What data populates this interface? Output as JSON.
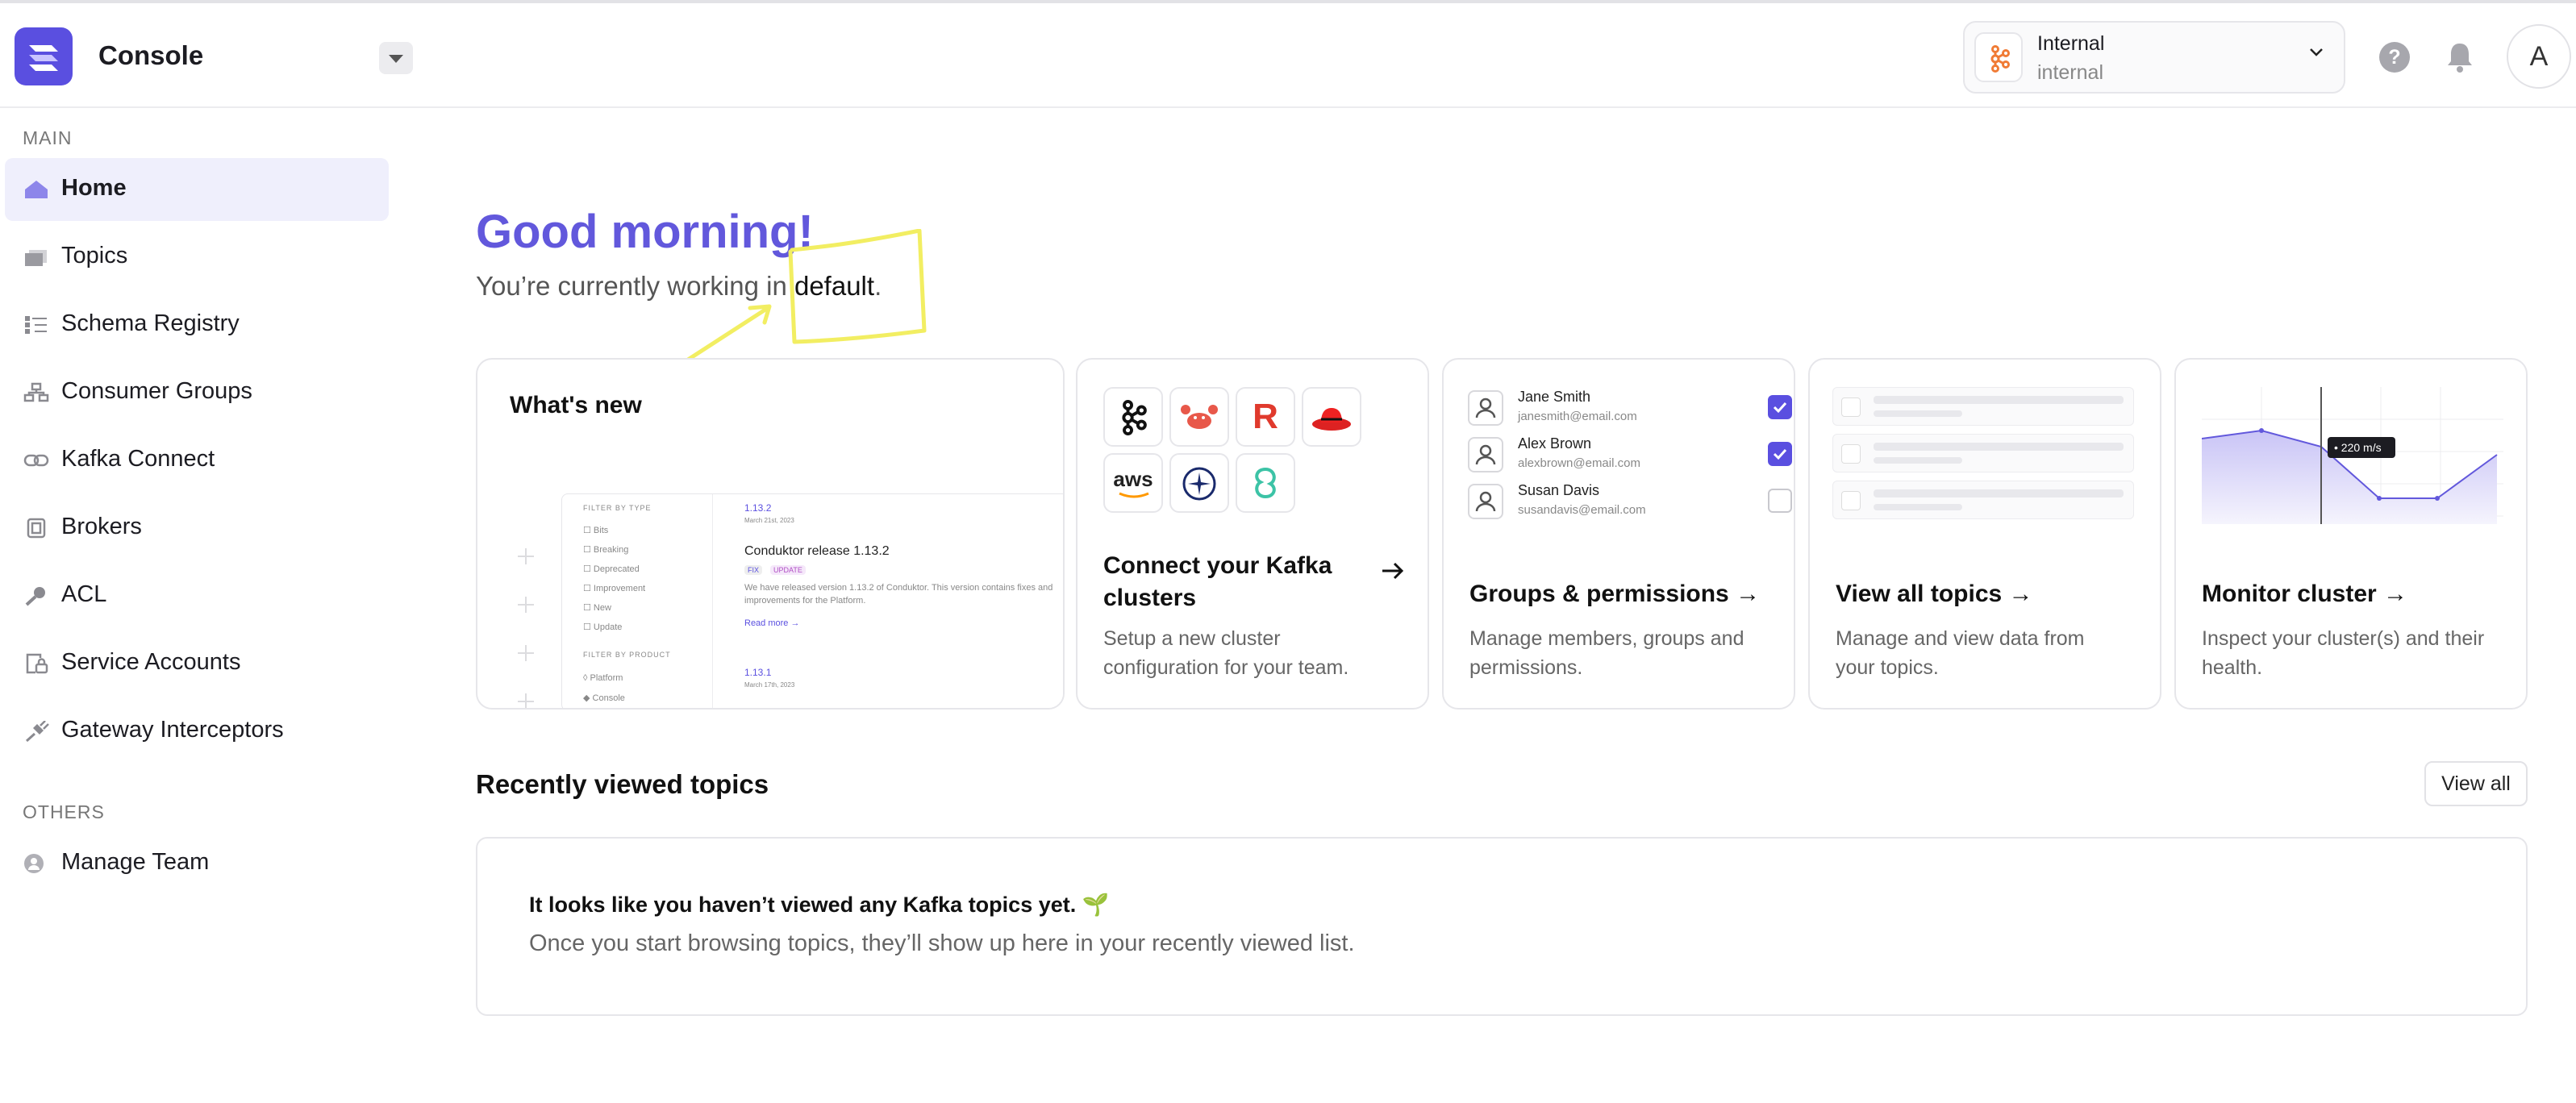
{
  "app": {
    "title": "Console"
  },
  "cluster": {
    "name": "Internal",
    "subtitle": "internal"
  },
  "help": {
    "label": "?"
  },
  "user": {
    "avatar_initial": "A"
  },
  "sidebar": {
    "sections": [
      {
        "title": "MAIN",
        "items": [
          {
            "label": "Home",
            "icon": "home-icon",
            "active": true
          },
          {
            "label": "Topics",
            "icon": "topics-icon"
          },
          {
            "label": "Schema Registry",
            "icon": "schema-icon"
          },
          {
            "label": "Consumer Groups",
            "icon": "consumer-groups-icon"
          },
          {
            "label": "Kafka Connect",
            "icon": "kafka-connect-icon"
          },
          {
            "label": "Brokers",
            "icon": "brokers-icon"
          },
          {
            "label": "ACL",
            "icon": "key-icon"
          },
          {
            "label": "Service Accounts",
            "icon": "service-accounts-icon"
          },
          {
            "label": "Gateway Interceptors",
            "icon": "plug-icon"
          }
        ]
      },
      {
        "title": "OTHERS",
        "items": [
          {
            "label": "Manage Team",
            "icon": "team-icon"
          }
        ]
      }
    ]
  },
  "main": {
    "greeting": "Good morning!",
    "working_prefix": "You’re currently working in ",
    "working_env": "default",
    "working_suffix": "."
  },
  "cards": {
    "whats_new": {
      "title": "What's new",
      "preview": {
        "filter_by_type": "FILTER BY TYPE",
        "types": [
          "Bits",
          "Breaking",
          "Deprecated",
          "Improvement",
          "New",
          "Update"
        ],
        "filter_by_product": "FILTER BY PRODUCT",
        "products": [
          "Platform",
          "Console"
        ],
        "version1": "1.13.2",
        "date1": "March 21st, 2023",
        "release_title": "Conduktor release 1.13.2",
        "badges": [
          "FIX",
          "UPDATE"
        ],
        "release_text_1": "We have released version 1.13.2 of Conduktor. This version contains fixes and",
        "release_text_2": "improvements for the Platform.",
        "read_more": "Read more →",
        "version2": "1.13.1",
        "date2": "March 17th, 2023"
      }
    },
    "connect": {
      "title_line1": "Connect your Kafka",
      "title_line2": "clusters",
      "desc_line1": "Setup a new cluster",
      "desc_line2": "configuration for your team.",
      "tiles": [
        "kafka-icon",
        "crab-icon",
        "redpanda-icon",
        "redhat-icon",
        "aws-icon",
        "aiven-icon",
        "confluent-icon"
      ],
      "aws_text": "aws",
      "redpanda_text": "R"
    },
    "groups": {
      "title": "Groups & permissions →",
      "desc_line1": "Manage members, groups and",
      "desc_line2": "permissions.",
      "members": [
        {
          "name": "Jane Smith",
          "email": "janesmith@email.com",
          "checked": true
        },
        {
          "name": "Alex Brown",
          "email": "alexbrown@email.com",
          "checked": true
        },
        {
          "name": "Susan Davis",
          "email": "susandavis@email.com",
          "checked": false
        }
      ]
    },
    "topics": {
      "title": "View all topics →",
      "desc_line1": "Manage and view data from",
      "desc_line2": "your topics."
    },
    "monitor": {
      "title": "Monitor cluster →",
      "desc_line1": "Inspect your cluster(s) and their",
      "desc_line2": "health.",
      "tooltip": "• 220 m/s"
    }
  },
  "recent": {
    "title": "Recently viewed topics",
    "view_all": "View all",
    "empty_title": "It looks like you haven’t viewed any Kafka topics yet. 🌱",
    "empty_text": "Once you start browsing topics, they’ll show up here in your recently viewed list."
  },
  "colors": {
    "accent": "#5a4fe0",
    "greeting": "#6258dc",
    "annotation": "#f2ee62"
  }
}
